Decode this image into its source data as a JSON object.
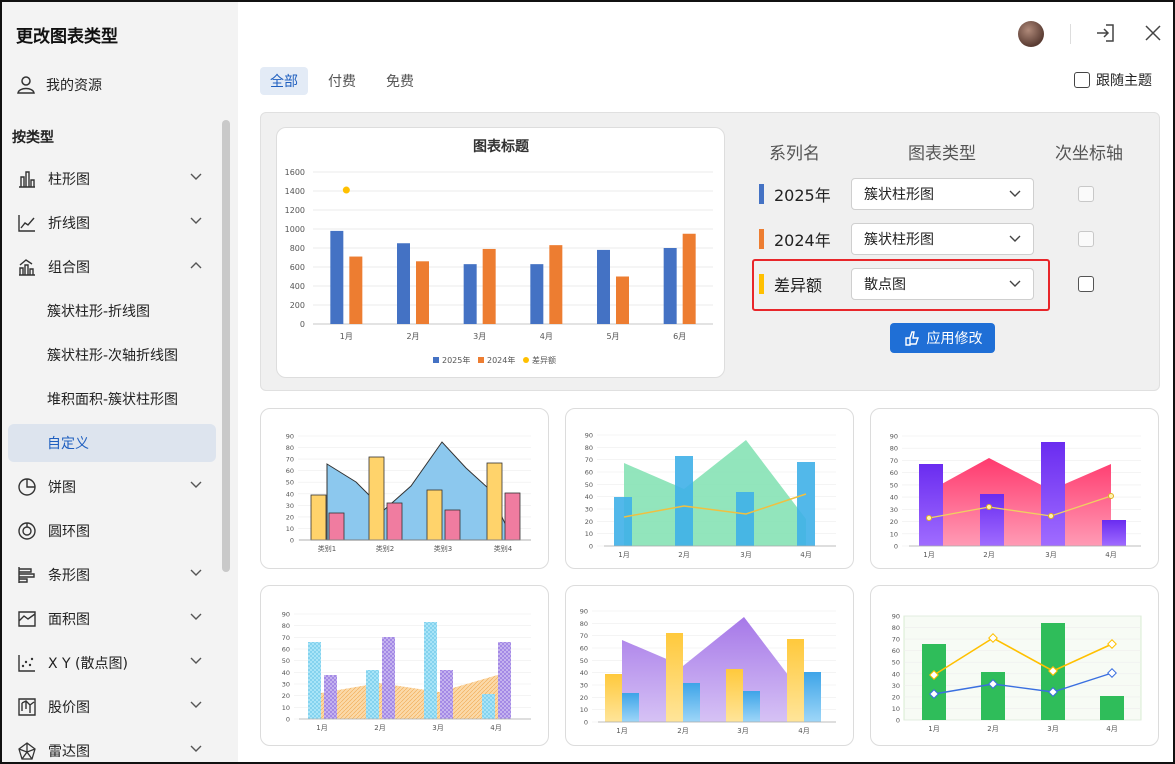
{
  "app": {
    "title": "更改图表类型"
  },
  "sidebar": {
    "my_resources": "我的资源",
    "by_type": "按类型",
    "items": [
      {
        "label": "柱形图",
        "icon": "bar-chart-icon",
        "expanded": false
      },
      {
        "label": "折线图",
        "icon": "line-chart-icon",
        "expanded": false
      },
      {
        "label": "组合图",
        "icon": "combo-chart-icon",
        "expanded": true
      },
      {
        "label": "饼图",
        "icon": "pie-chart-icon",
        "expanded": false
      },
      {
        "label": "圆环图",
        "icon": "donut-chart-icon",
        "expanded": false
      },
      {
        "label": "条形图",
        "icon": "hbar-chart-icon",
        "expanded": false
      },
      {
        "label": "面积图",
        "icon": "area-chart-icon",
        "expanded": false
      },
      {
        "label": "X Y (散点图)",
        "icon": "scatter-chart-icon",
        "expanded": false
      },
      {
        "label": "股价图",
        "icon": "stock-chart-icon",
        "expanded": false
      },
      {
        "label": "雷达图",
        "icon": "radar-chart-icon",
        "expanded": false
      }
    ],
    "sub_items": [
      {
        "label": "簇状柱形-折线图"
      },
      {
        "label": "簇状柱形-次轴折线图"
      },
      {
        "label": "堆积面积-簇状柱形图"
      },
      {
        "label": "自定义",
        "active": true
      }
    ]
  },
  "tabs": [
    {
      "label": "全部",
      "active": true
    },
    {
      "label": "付费"
    },
    {
      "label": "免费"
    }
  ],
  "follow_theme": {
    "label": "跟随主题",
    "checked": false
  },
  "config": {
    "headers": {
      "series": "系列名",
      "type": "图表类型",
      "secondary": "次坐标轴"
    },
    "rows": [
      {
        "name": "2025年",
        "color": "#4472c4",
        "type": "簇状柱形图",
        "secondary": false,
        "enabled": false
      },
      {
        "name": "2024年",
        "color": "#ed7d31",
        "type": "簇状柱形图",
        "secondary": false,
        "enabled": false
      },
      {
        "name": "差异额",
        "color": "#ffc000",
        "type": "散点图",
        "secondary": false,
        "enabled": true
      }
    ],
    "apply_label": "应用修改"
  },
  "chart_data": {
    "type": "bar",
    "title": "图表标题",
    "categories": [
      "1月",
      "2月",
      "3月",
      "4月",
      "5月",
      "6月"
    ],
    "series": [
      {
        "name": "2025年",
        "type": "bar",
        "color": "#4472c4",
        "values": [
          980,
          850,
          630,
          630,
          780,
          800
        ]
      },
      {
        "name": "2024年",
        "type": "bar",
        "color": "#ed7d31",
        "values": [
          710,
          660,
          790,
          830,
          500,
          950
        ]
      },
      {
        "name": "差异额",
        "type": "scatter",
        "color": "#ffc000",
        "values": [
          1410,
          null,
          null,
          null,
          null,
          null
        ]
      }
    ],
    "ylim": [
      0,
      1600
    ],
    "yticks": [
      "0",
      "200",
      "400",
      "600",
      "800",
      "1000",
      "1200",
      "1400",
      "1600"
    ],
    "legend": "bottom",
    "grid": true
  },
  "templates": [
    {
      "name": "template-1",
      "cats": [
        "类别1",
        "类别2",
        "类别3",
        "类别4"
      ],
      "yticks": [
        "0",
        "10",
        "20",
        "30",
        "40",
        "50",
        "60",
        "70",
        "80",
        "90"
      ]
    },
    {
      "name": "template-2",
      "cats": [
        "1月",
        "2月",
        "3月",
        "4月"
      ],
      "yticks": [
        "0",
        "10",
        "20",
        "30",
        "40",
        "50",
        "60",
        "70",
        "80",
        "90"
      ]
    },
    {
      "name": "template-3",
      "cats": [
        "1月",
        "2月",
        "3月",
        "4月"
      ],
      "yticks": [
        "0",
        "10",
        "20",
        "30",
        "40",
        "50",
        "60",
        "70",
        "80",
        "90"
      ]
    },
    {
      "name": "template-4",
      "cats": [
        "1月",
        "2月",
        "3月",
        "4月"
      ],
      "yticks": [
        "0",
        "10",
        "20",
        "30",
        "40",
        "50",
        "60",
        "70",
        "80",
        "90"
      ]
    },
    {
      "name": "template-5",
      "cats": [
        "1月",
        "2月",
        "3月",
        "4月"
      ],
      "yticks": [
        "0",
        "10",
        "20",
        "30",
        "40",
        "50",
        "60",
        "70",
        "80",
        "90"
      ]
    },
    {
      "name": "template-6",
      "cats": [
        "1月",
        "2月",
        "3月",
        "4月"
      ],
      "yticks": [
        "0",
        "10",
        "20",
        "30",
        "40",
        "50",
        "60",
        "70",
        "80",
        "90"
      ]
    }
  ]
}
